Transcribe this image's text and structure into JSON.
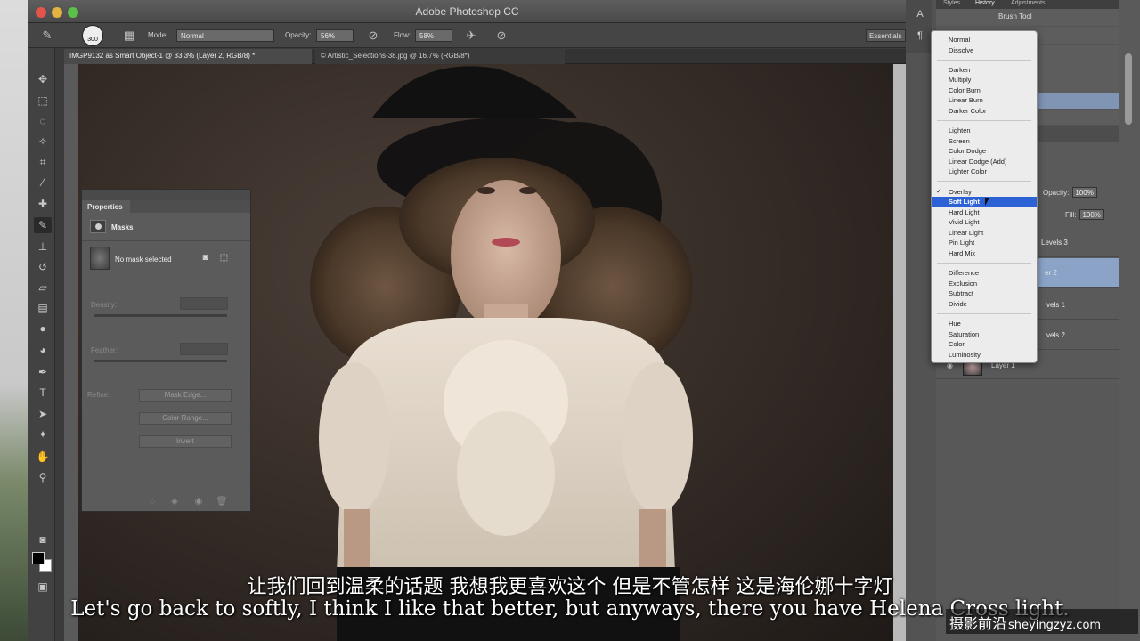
{
  "window": {
    "app_title": "Adobe Photoshop CC"
  },
  "options_bar": {
    "brush_size": "300",
    "mode_label": "Mode:",
    "mode_value": "Normal",
    "opacity_label": "Opacity:",
    "opacity_value": "56%",
    "flow_label": "Flow:",
    "flow_value": "58%",
    "workspace": "Essentials"
  },
  "tabs": [
    {
      "label": "IMGP9132 as Smart Object-1 @ 33.3% (Layer 2, RGB/8) *"
    },
    {
      "label": "© Artistic_Selections-38.jpg @ 16.7% (RGB/8*)"
    }
  ],
  "properties_panel": {
    "title": "Properties",
    "section": "Masks",
    "no_mask": "No mask selected",
    "density_label": "Density:",
    "feather_label": "Feather:",
    "refine_label": "Refine:",
    "buttons": [
      "Mask Edge...",
      "Color Range...",
      "Invert"
    ]
  },
  "right_panel": {
    "tabs": [
      "Styles",
      "History",
      "Adjustments"
    ],
    "history": [
      "Brush Tool",
      "Brush Tool"
    ],
    "opacity_label": "Opacity:",
    "opacity_value": "100%",
    "fill_label": "Fill:",
    "fill_value": "100%",
    "layers": [
      "Levels 3",
      "er 2",
      "vels 1",
      "vels 2"
    ],
    "layer1_name": "Layer 1"
  },
  "blend_menu": {
    "groups": [
      [
        "Normal",
        "Dissolve"
      ],
      [
        "Darken",
        "Multiply",
        "Color Burn",
        "Linear Burn",
        "Darker Color"
      ],
      [
        "Lighten",
        "Screen",
        "Color Dodge",
        "Linear Dodge (Add)",
        "Lighter Color"
      ],
      [
        "Overlay",
        "Soft Light",
        "Hard Light",
        "Vivid Light",
        "Linear Light",
        "Pin Light",
        "Hard Mix"
      ],
      [
        "Difference",
        "Exclusion",
        "Subtract",
        "Divide"
      ],
      [
        "Hue",
        "Saturation",
        "Color",
        "Luminosity"
      ]
    ],
    "checked": "Overlay",
    "highlighted": "Soft Light"
  },
  "subtitles": {
    "chinese": "让我们回到温柔的话题 我想我更喜欢这个 但是不管怎样 这是海伦娜十字灯",
    "english": "Let's go back to softly, I think I like that better, but anyways, there you have Helena Cross light."
  },
  "watermark": {
    "name": "摄影前沿",
    "url": "sheyingzyz.com"
  },
  "colors": {
    "menu_highlight": "#2d62d6",
    "selected_layer": "#8aa3c6"
  }
}
